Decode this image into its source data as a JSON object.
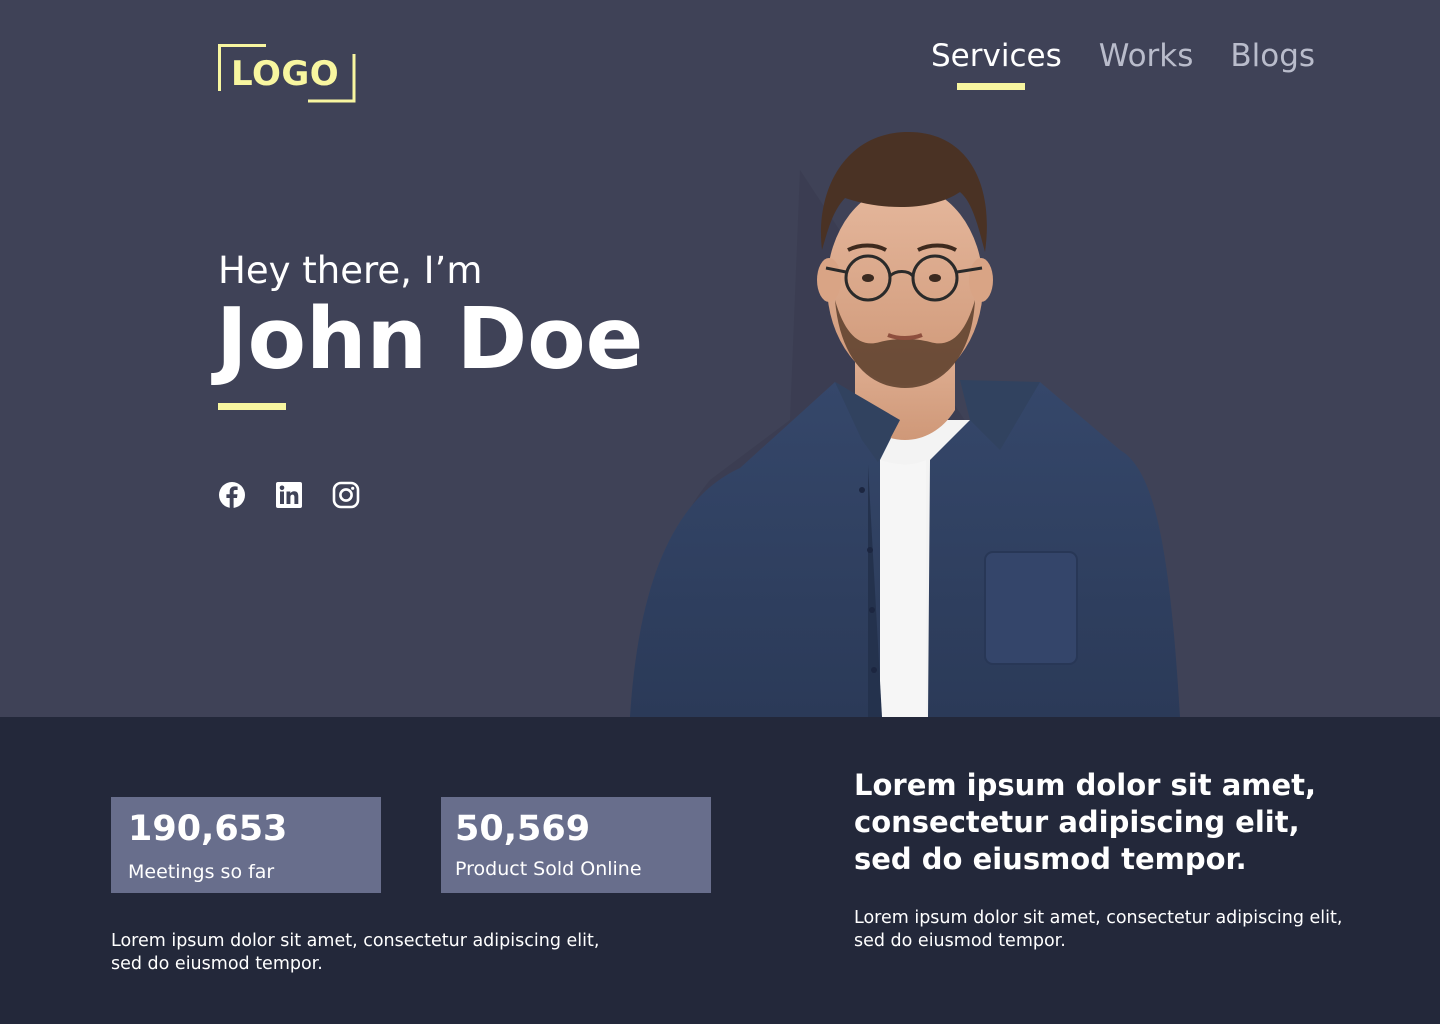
{
  "header": {
    "logo_text": "LOGO",
    "nav": [
      {
        "label": "Services"
      },
      {
        "label": "Works"
      },
      {
        "label": "Blogs"
      }
    ]
  },
  "hero": {
    "greeting": "Hey there, I’m",
    "name": "John Doe",
    "social": [
      "facebook-icon",
      "linkedin-icon",
      "instagram-icon"
    ]
  },
  "stats": [
    {
      "value": "190,653",
      "label": "Meetings so far"
    },
    {
      "value": "50,569",
      "label": "Product Sold Online"
    }
  ],
  "left_paragraph": {
    "line1": "Lorem ipsum dolor sit amet, consectetur adipiscing elit,",
    "line2": "sed do eiusmod tempor."
  },
  "right_heading": {
    "line1": "Lorem ipsum dolor sit amet,",
    "line2": "consectetur adipiscing elit,",
    "line3": "sed do eiusmod tempor."
  },
  "right_paragraph": {
    "line1": "Lorem ipsum dolor sit amet, consectetur adipiscing elit,",
    "line2": "sed do eiusmod tempor."
  },
  "colors": {
    "hero_bg": "#3f4257",
    "bottom_bg": "#23283a",
    "accent": "#f8f6a0",
    "card_bg": "#686e8c"
  }
}
